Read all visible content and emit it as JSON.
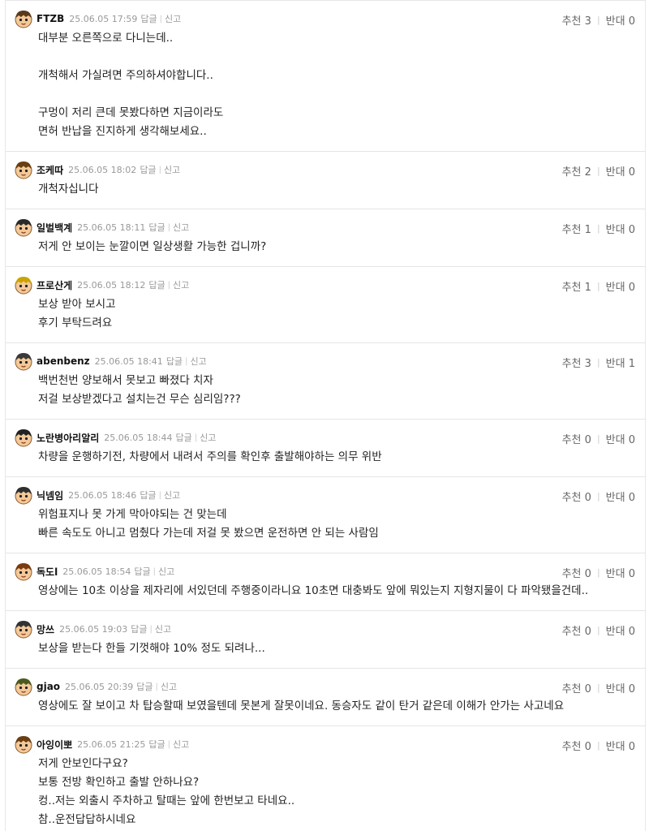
{
  "actions": {
    "reply_label": "답글",
    "report_label": "신고"
  },
  "vote_labels": {
    "up": "추천",
    "down": "반대"
  },
  "comments": [
    {
      "nick": "FTZB",
      "time": "25.06.05 17:59",
      "up": "3",
      "down": "0",
      "hair": "#5a3a1a",
      "lines": [
        "대부분 오른쪽으로 다니는데..",
        "",
        "개척해서 가실려면 주의하셔야합니다..",
        "",
        "구멍이 저리 큰데 못봤다하면 지금이라도",
        "면허 반납을 진지하게 생각해보세요.."
      ]
    },
    {
      "nick": "조케따",
      "time": "25.06.05 18:02",
      "up": "2",
      "down": "0",
      "hair": "#6b3e12",
      "lines": [
        "개척자십니다"
      ]
    },
    {
      "nick": "일벌백계",
      "time": "25.06.05 18:11",
      "up": "1",
      "down": "0",
      "hair": "#2a2a2a",
      "lines": [
        "저게 안 보이는 눈깔이면 일상생활 가능한 겁니까?"
      ]
    },
    {
      "nick": "프로산게",
      "time": "25.06.05 18:12",
      "up": "1",
      "down": "0",
      "hair": "#c9a400",
      "lines": [
        "보상 받아 보시고",
        "후기 부탁드려요"
      ]
    },
    {
      "nick": "abenbenz",
      "time": "25.06.05 18:41",
      "up": "3",
      "down": "1",
      "hair": "#3a3a3a",
      "lines": [
        "백번천번 양보해서 못보고 빠졌다 치자",
        "저걸 보상받겠다고 설치는건 무슨 심리임???"
      ]
    },
    {
      "nick": "노란병아리알리",
      "time": "25.06.05 18:44",
      "up": "0",
      "down": "0",
      "hair": "#222222",
      "lines": [
        "차량을 운행하기전, 차량에서 내려서 주의를 확인후 출발해야하는 의무 위반"
      ]
    },
    {
      "nick": "닉넴임",
      "time": "25.06.05 18:46",
      "up": "0",
      "down": "0",
      "hair": "#2f2f2f",
      "lines": [
        "위험표지나 못 가게 막아야되는 건 맞는데",
        "빠른 속도도 아니고 멈췄다 가는데 저걸 못 봤으면 운전하면 안 되는 사람임"
      ]
    },
    {
      "nick": "독도l",
      "time": "25.06.05 18:54",
      "up": "0",
      "down": "0",
      "hair": "#7a3b10",
      "lines": [
        "영상에는 10초 이상을 제자리에 서있던데 주행중이라니요 10초면 대충봐도 앞에 뭐있는지 지형지물이 다 파악됐을건데.."
      ]
    },
    {
      "nick": "망쓰",
      "time": "25.06.05 19:03",
      "up": "0",
      "down": "0",
      "hair": "#333333",
      "lines": [
        "보상을 받는다 한들 기껏해야 10% 정도 되려나..."
      ]
    },
    {
      "nick": "gjao",
      "time": "25.06.05 20:39",
      "up": "0",
      "down": "0",
      "hair": "#4b5a1e",
      "lines": [
        "영상에도 잘 보이고 차 탑승할때 보였을텐데 못본게 잘못이네요. 동승자도 같이 탄거 같은데 이해가 안가는 사고네요"
      ]
    },
    {
      "nick": "아잉이뽀",
      "time": "25.06.05 21:25",
      "up": "0",
      "down": "0",
      "hair": "#6b3e12",
      "lines": [
        "저게 안보인다구요?",
        "보통 전방 확인하고 출발 안하나요?",
        "컹..저는 외출시 주차하고 탈때는 앞에 한번보고 타네요..",
        "참..운전답답하시네요"
      ]
    }
  ]
}
